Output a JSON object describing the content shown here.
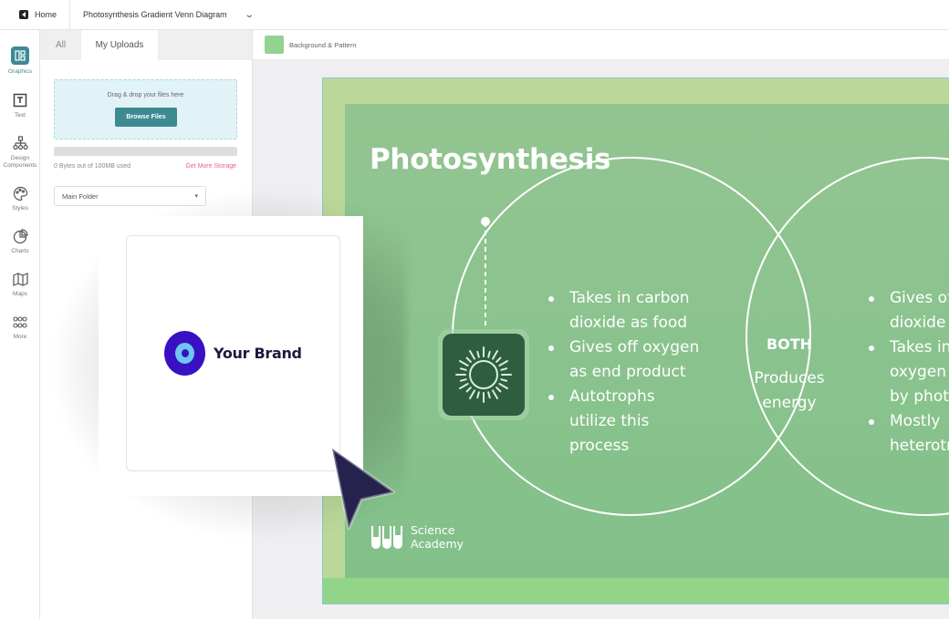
{
  "topbar": {
    "home_label": "Home",
    "document_title": "Photosynthesis Gradient Venn Diagram",
    "chevron": "⌄"
  },
  "rail": {
    "items": [
      {
        "label": "Graphics",
        "icon": "graphics-icon",
        "active": true
      },
      {
        "label": "Text",
        "icon": "text-icon"
      },
      {
        "label": "Design Components",
        "icon": "design-components-icon"
      },
      {
        "label": "Styles",
        "icon": "palette-icon"
      },
      {
        "label": "Charts",
        "icon": "pie-chart-icon"
      },
      {
        "label": "Maps",
        "icon": "map-icon"
      },
      {
        "label": "More",
        "icon": "grid-dots-icon"
      }
    ]
  },
  "panel": {
    "tabs": [
      {
        "label": "All",
        "active": false
      },
      {
        "label": "My Uploads",
        "active": true
      }
    ],
    "dropzone_text": "Drag & drop your files here",
    "browse_label": "Browse Files",
    "storage_used_fraction": 0,
    "storage_text": "0 Bytes out of 100MB used",
    "storage_link": "Get More Storage",
    "folder_selected": "Main Folder",
    "folder_chevron": "⌄"
  },
  "canvas_toolbar": {
    "background_label": "Background & Pattern",
    "swatch_color": "#93d290"
  },
  "slide": {
    "title": "Photosynthesis",
    "left_bullets": [
      [
        "Takes in carbon",
        "dioxide as food"
      ],
      [
        "Gives off oxygen",
        "as end product"
      ],
      [
        "Autotrophs",
        "utilize this",
        "process"
      ]
    ],
    "right_bullets": [
      [
        "Gives off carbon",
        "dioxide"
      ],
      [
        "Takes in",
        "oxygen",
        "by photosynthesis"
      ],
      [
        "Mostly",
        "heterotrophs"
      ]
    ],
    "both_title": "BOTH",
    "both_text_1": "Produces",
    "both_text_2": "energy",
    "logo_line1": "Science",
    "logo_line2": "Academy",
    "colors": {
      "outer_border": "#bcd899",
      "inner_bg": "#8cc38e",
      "bottom_strip": "#92d488",
      "sun_tile": "#2f5d3f"
    }
  },
  "drag_card": {
    "brand_name": "Your Brand",
    "brand_color": "#3a10c4",
    "brand_accent": "#6cc8ee"
  }
}
